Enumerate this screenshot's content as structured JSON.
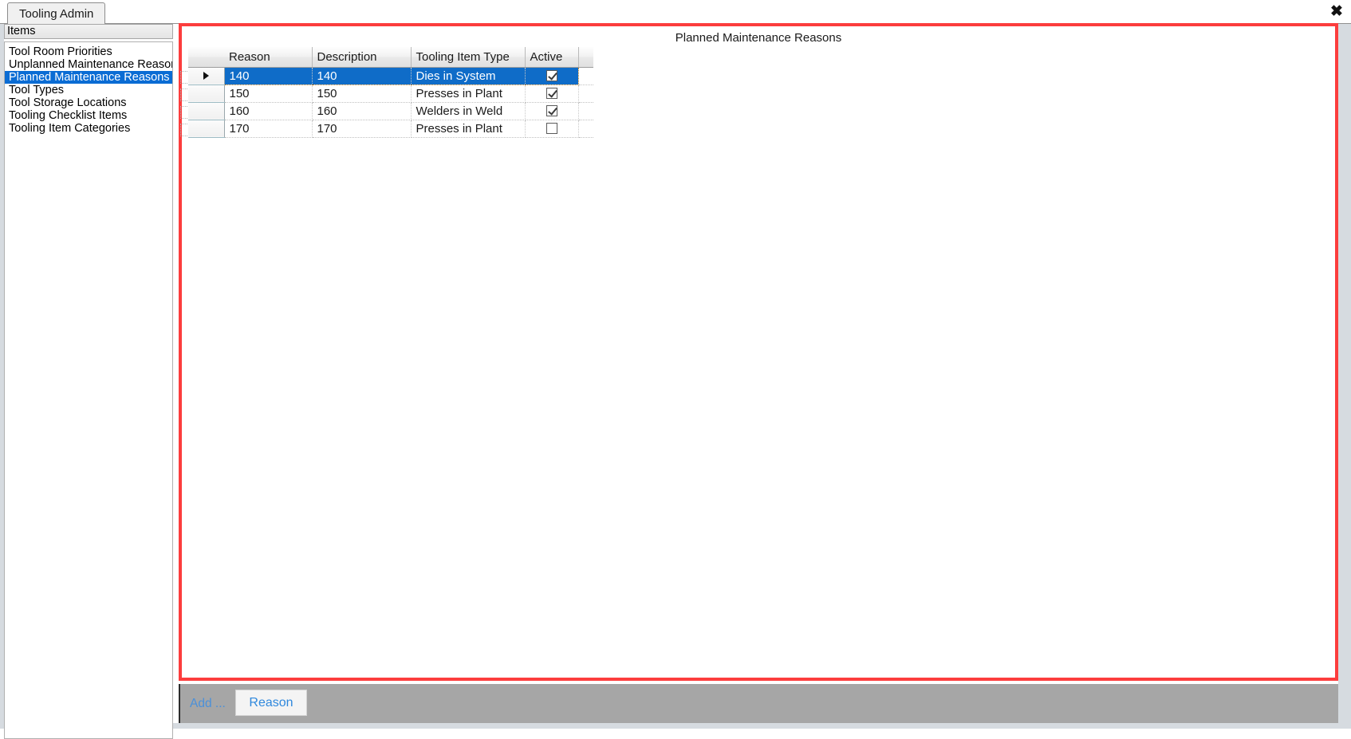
{
  "window": {
    "tab_label": "Tooling Admin",
    "close_icon": "close-icon",
    "close_glyph": "✖"
  },
  "sidebar": {
    "header": "Items",
    "items": [
      {
        "label": "Tool Room Priorities",
        "selected": false
      },
      {
        "label": "Unplanned Maintenance Reasons",
        "selected": false
      },
      {
        "label": "Planned Maintenance Reasons",
        "selected": true
      },
      {
        "label": "Tool Types",
        "selected": false
      },
      {
        "label": "Tool Storage Locations",
        "selected": false
      },
      {
        "label": "Tooling Checklist Items",
        "selected": false
      },
      {
        "label": "Tooling Item Categories",
        "selected": false
      }
    ]
  },
  "main": {
    "title": "Planned Maintenance Reasons",
    "grid": {
      "columns": [
        "Reason",
        "Description",
        "Tooling Item Type",
        "Active"
      ],
      "rows": [
        {
          "reason": "140",
          "description": "140",
          "tooling_item_type": "Dies in System",
          "active": true,
          "selected": true
        },
        {
          "reason": "150",
          "description": "150",
          "tooling_item_type": "Presses in Plant",
          "active": true,
          "selected": false
        },
        {
          "reason": "160",
          "description": "160",
          "tooling_item_type": "Welders in Weld",
          "active": true,
          "selected": false
        },
        {
          "reason": "170",
          "description": "170",
          "tooling_item_type": "Presses in Plant",
          "active": false,
          "selected": false
        }
      ]
    }
  },
  "bottom_bar": {
    "add_label": "Add ...",
    "reason_button": "Reason"
  },
  "colors": {
    "panel_border": "#fc3d3d",
    "selection": "#0f6cc8",
    "sidebar_selection": "#0a6cd4",
    "link": "#4a90d9",
    "button_text": "#2f88dd",
    "toolbar_bg": "#a6a6a6"
  }
}
